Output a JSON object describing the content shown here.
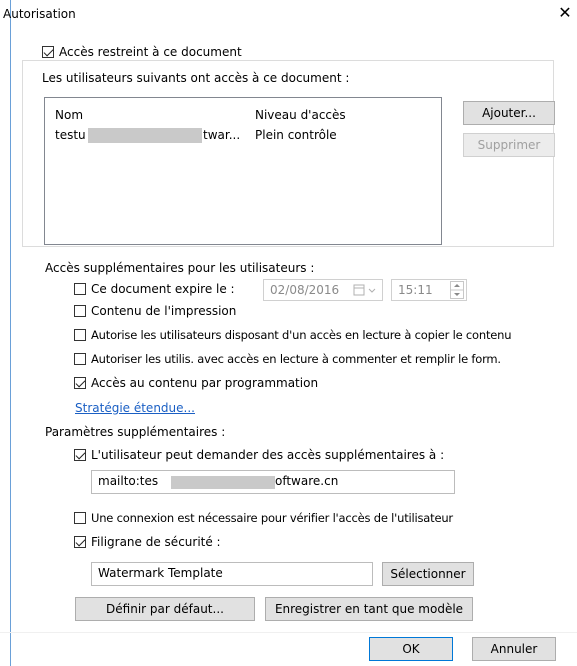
{
  "window": {
    "title": "Autorisation",
    "close_glyph": "✕"
  },
  "restrict": {
    "label": "Accès restreint à ce document",
    "checked": true
  },
  "users": {
    "label": "Les utilisateurs suivants ont accès à ce document :",
    "col_name": "Nom",
    "col_level": "Niveau d'accès",
    "rows": [
      {
        "name_start": "testu",
        "name_end": "twar...",
        "level": "Plein contrôle"
      }
    ]
  },
  "buttons": {
    "add": "Ajouter...",
    "remove": "Supprimer",
    "default": "Définir par défaut...",
    "save_template": "Enregistrer en tant que modèle",
    "select": "Sélectionner",
    "ok": "OK",
    "cancel": "Annuler"
  },
  "extra_access": {
    "label": "Accès supplémentaires pour les utilisateurs :",
    "expire": {
      "label": "Ce document expire le :",
      "checked": false,
      "date": "02/08/2016",
      "time": "15:11"
    },
    "print": {
      "label": "Contenu de l'impression",
      "checked": false
    },
    "copy": {
      "label": "Autorise les utilisateurs disposant d'un accès en lecture à copier le contenu",
      "checked": false
    },
    "comment": {
      "label": "Autoriser les utilis. avec accès en lecture à commenter et remplir le form.",
      "checked": false
    },
    "program": {
      "label": "Accès au contenu par programmation",
      "checked": true
    },
    "policy_link": "Stratégie étendue..."
  },
  "extra_params": {
    "label": "Paramètres supplémentaires :",
    "request": {
      "label": "L'utilisateur peut demander des accès supplémentaires à :",
      "checked": true,
      "email_start": "mailto:tes",
      "email_end": "oftware.cn"
    },
    "connection": {
      "label": "Une connexion est nécessaire pour vérifier l'accès de l'utilisateur",
      "checked": false
    },
    "watermark": {
      "label": "Filigrane de sécurité :",
      "checked": true,
      "template": "Watermark Template"
    }
  },
  "icons": {
    "calendar": "calendar-icon",
    "spin": "spin-arrows-icon"
  },
  "colors": {
    "link": "#1a5fc4",
    "accent_border": "#0078d7",
    "window_edge": "#6aa0d8"
  }
}
